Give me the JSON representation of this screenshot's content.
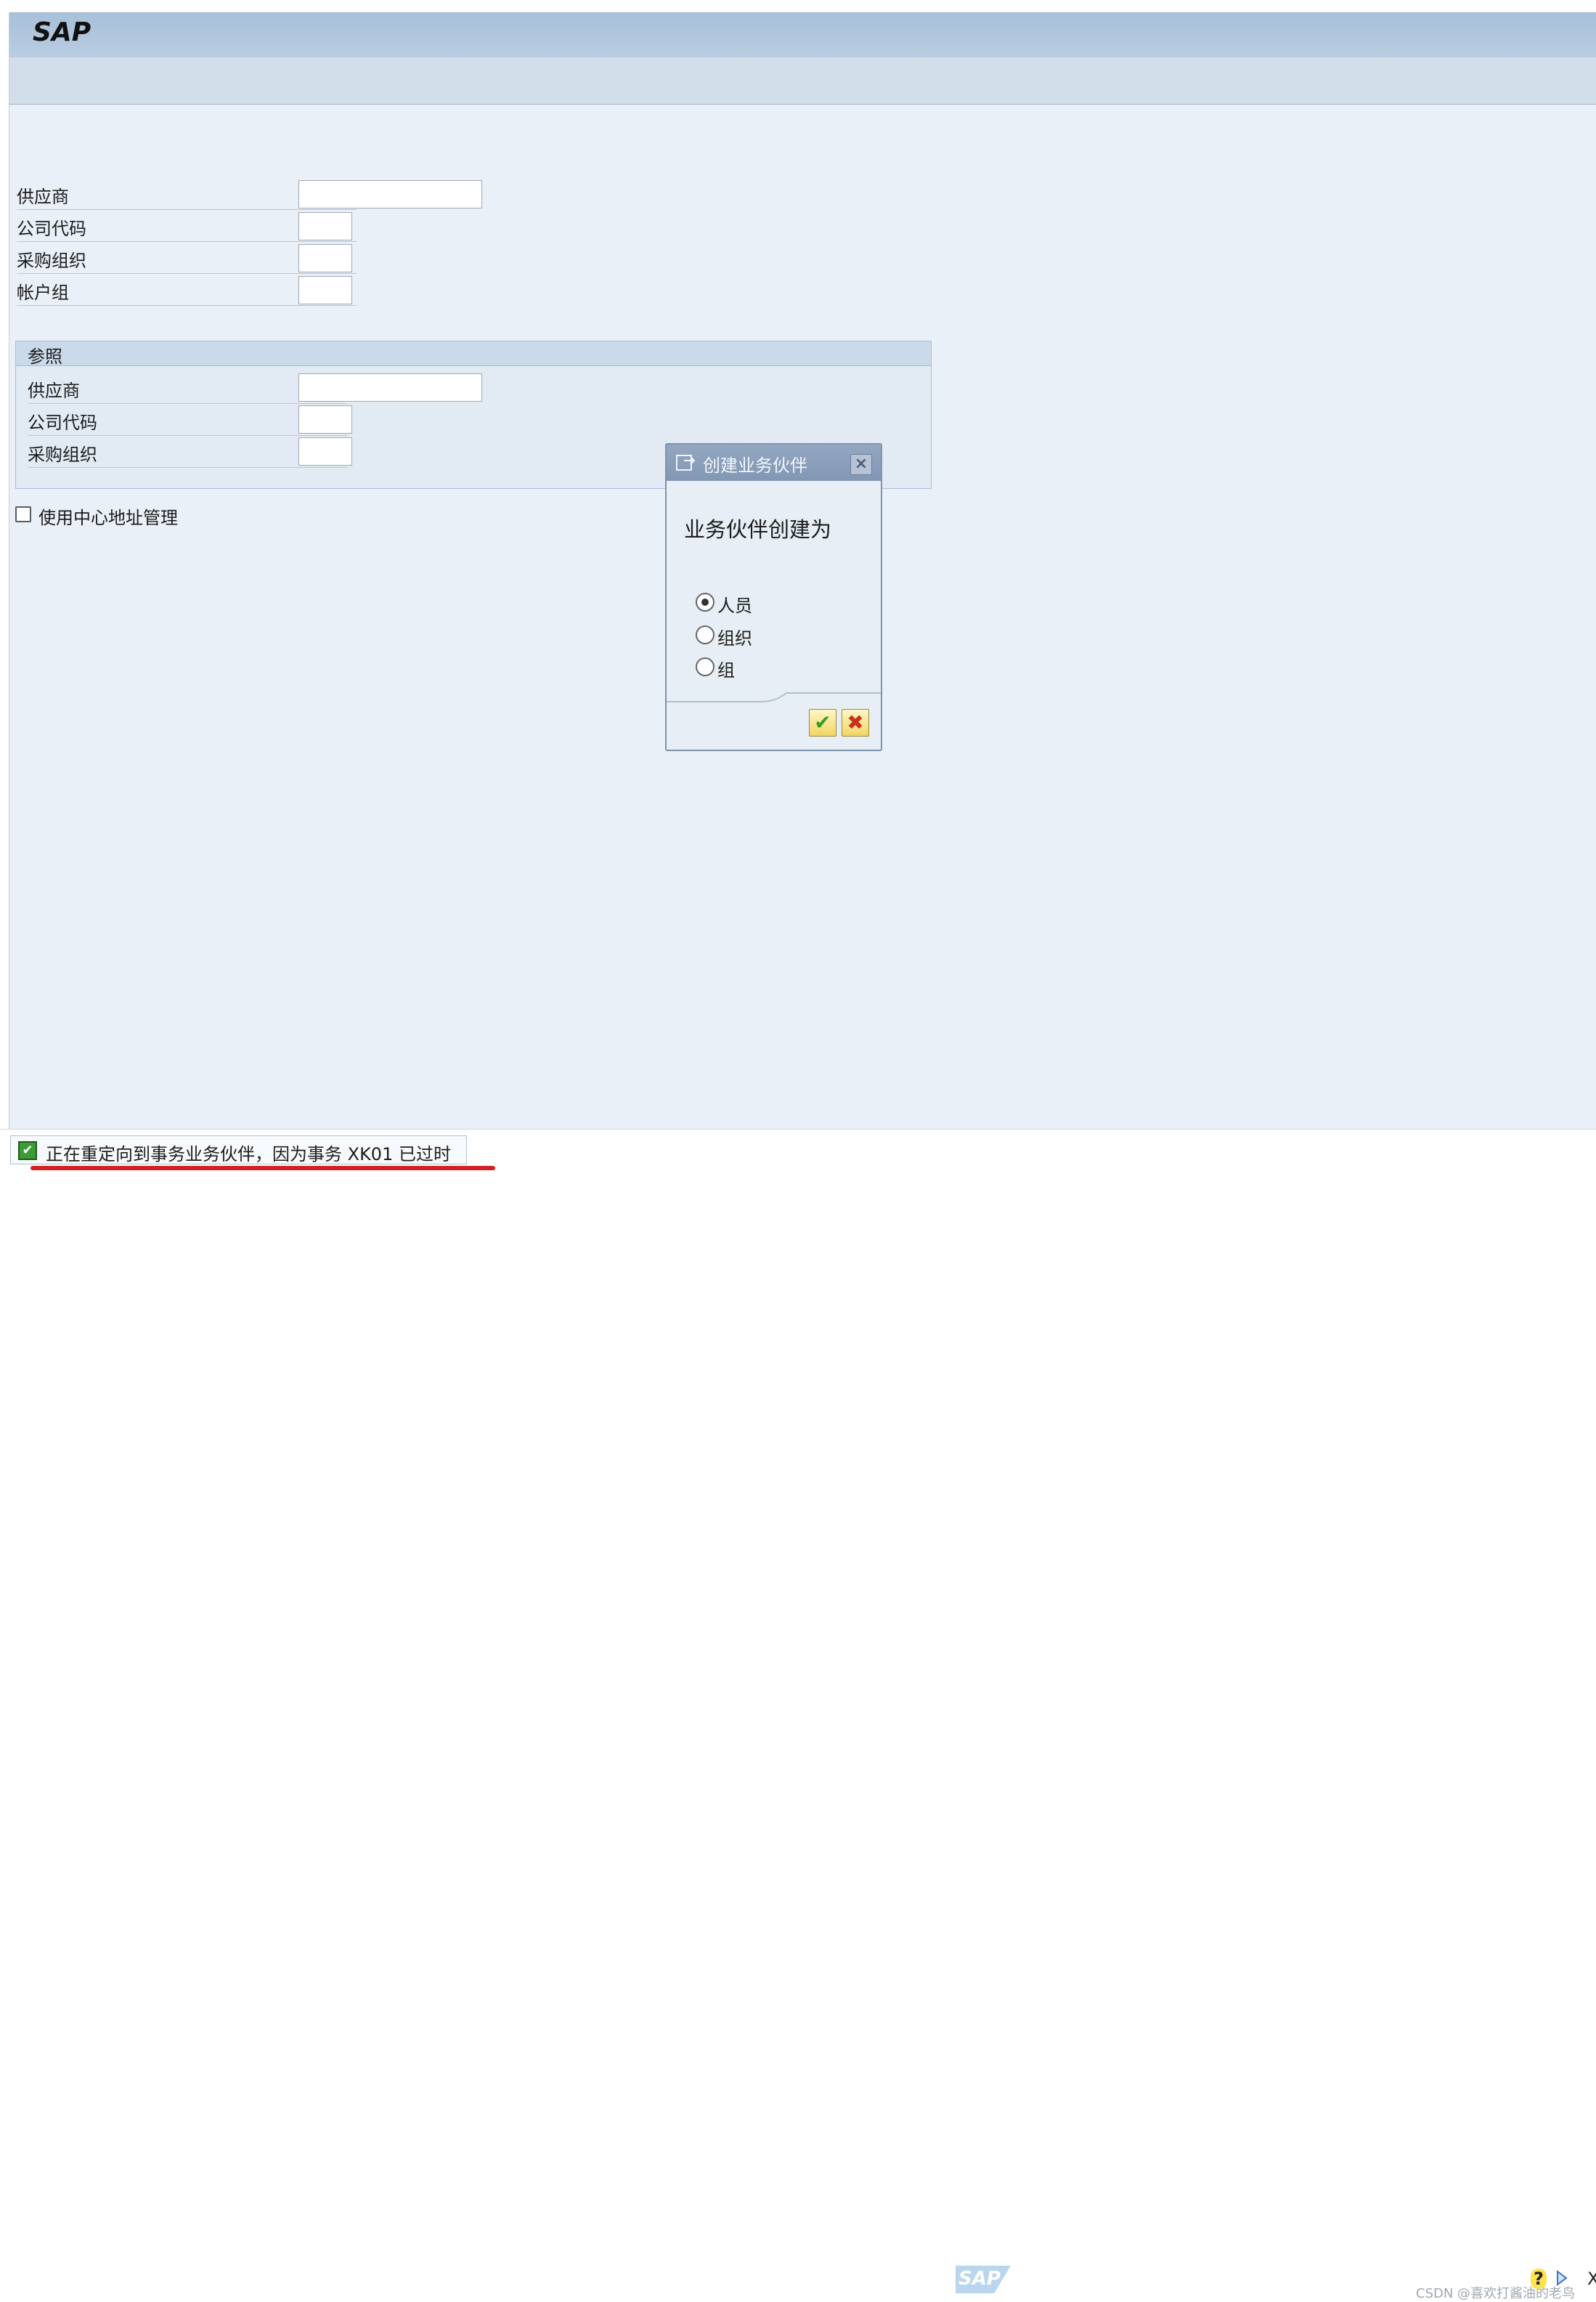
{
  "header": {
    "logo": "SAP"
  },
  "form": {
    "rows": [
      {
        "label": "供应商",
        "value": ""
      },
      {
        "label": "公司代码",
        "value": ""
      },
      {
        "label": "采购组织",
        "value": ""
      },
      {
        "label": "帐户组",
        "value": ""
      }
    ]
  },
  "reference": {
    "title": "参照",
    "rows": [
      {
        "label": "供应商",
        "value": ""
      },
      {
        "label": "公司代码",
        "value": ""
      },
      {
        "label": "采购组织",
        "value": ""
      }
    ]
  },
  "central_address": {
    "label": "使用中心地址管理",
    "checked": false
  },
  "dialog": {
    "title": "创建业务伙伴",
    "prompt": "业务伙伴创建为",
    "options": [
      {
        "label": "人员",
        "selected": true
      },
      {
        "label": "组织",
        "selected": false
      },
      {
        "label": "组",
        "selected": false
      }
    ],
    "close_symbol": "×",
    "ok_symbol": "✔",
    "cancel_symbol": "✖"
  },
  "statusbar": {
    "message": "正在重定向到事务业务伙伴，因为事务 XK01 已过时",
    "message_icon": "✔",
    "watermark": "SAP",
    "csdn": "CSDN @喜欢打酱油的老鸟",
    "help_symbol": "?",
    "trailing": "X"
  },
  "colors": {
    "accent_blue": "#8197b4",
    "background": "#e9f0f7",
    "status_ok": "#3d9b35",
    "highlight_red": "#d51f24"
  }
}
